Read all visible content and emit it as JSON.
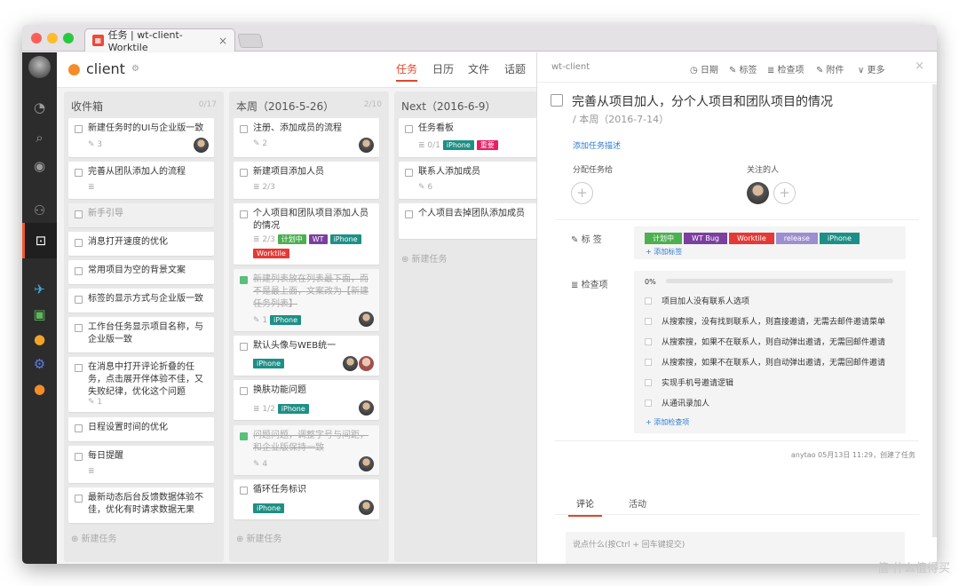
{
  "browser": {
    "tab_title": "任务 | wt-client-Worktile",
    "tab_icon": "worktile-icon"
  },
  "header": {
    "project": "client",
    "views": [
      {
        "label": "任务",
        "active": true
      },
      {
        "label": "日历",
        "active": false
      },
      {
        "label": "文件",
        "active": false
      },
      {
        "label": "话题",
        "active": false
      }
    ]
  },
  "columns": [
    {
      "title": "收件箱",
      "count": "0/17",
      "new_task": "⊕ 新建任务",
      "cards": [
        {
          "title": "新建任务时的UI与企业版一致",
          "meta": "✎ 3",
          "done": false
        },
        {
          "title": "完善从团队添加人的流程",
          "meta": "≣",
          "done": false
        },
        {
          "title": "新手引导",
          "meta": "",
          "done": false
        },
        {
          "title": "消息打开速度的优化",
          "meta": "",
          "done": false
        },
        {
          "title": "常用项目为空的背景文案",
          "meta": "",
          "done": false
        },
        {
          "title": "标签的显示方式与企业版一致",
          "meta": "",
          "done": false
        },
        {
          "title": "工作台任务显示项目名称，与企业版一致",
          "meta": "",
          "done": false
        },
        {
          "title": "在消息中打开评论折叠的任务，点击展开伴体验不佳，又失败纪律，优化这个问题",
          "meta": "✎ 1",
          "done": false
        },
        {
          "title": "日程设置时间的优化",
          "meta": "",
          "done": false
        },
        {
          "title": "每日提醒",
          "meta": "≣",
          "done": false
        },
        {
          "title": "最新动态后台反馈数据体验不佳，优化有时请求数据无果",
          "meta": "",
          "done": false
        }
      ]
    },
    {
      "title": "本周（2016-5-26）",
      "count": "2/10",
      "new_task": "⊕ 新建任务",
      "cards": [
        {
          "title": "注册、添加成员的流程",
          "meta": "✎ 2",
          "done": false
        },
        {
          "title": "新建项目添加人员",
          "meta": "≣ 2/3",
          "done": false
        },
        {
          "title": "个人项目和团队项目添加人员的情况",
          "meta": "≣ 2/3",
          "done": false,
          "tags": [
            "计划中",
            "WT",
            "iPhone",
            "Worktile"
          ]
        },
        {
          "title": "新建列表放在列表最下面，而不是最上面，文案改为【新建任务列表】",
          "meta": "✎ 1",
          "done": true,
          "tags": [
            "iPhone"
          ]
        },
        {
          "title": "默认头像与WEB统一",
          "meta": "",
          "done": false,
          "tags": [
            "iPhone"
          ]
        },
        {
          "title": "换肤功能问题",
          "meta": "≣ 1/2",
          "done": false,
          "tags": [
            "iPhone"
          ]
        },
        {
          "title": "问题问题，调整字号与间距，和企业版保持一致",
          "meta": "✎ 4",
          "done": true
        },
        {
          "title": "循环任务标识",
          "meta": "",
          "done": false,
          "tags": [
            "iPhone"
          ]
        }
      ]
    },
    {
      "title": "Next（2016-6-9）",
      "count": "",
      "new_task": "⊕ 新建任务",
      "cards": [
        {
          "title": "任务看板",
          "meta": "≣ 0/1",
          "done": false,
          "tags": [
            "iPhone",
            "重要"
          ]
        },
        {
          "title": "联系人添加成员",
          "meta": "✎ 6",
          "done": false
        },
        {
          "title": "个人项目去掉团队添加成员",
          "meta": "",
          "done": false
        }
      ]
    }
  ],
  "tag_colors": {
    "计划中": "#4caf50",
    "WT": "#7b3fa0",
    "iPhone": "#1e8f86",
    "Worktile": "#e53935",
    "重要": "#e91e63",
    "WT Bug": "#7b3fa0",
    "release": "#9c8fd0"
  },
  "detail": {
    "project": "wt-client",
    "actions": [
      "◷ 日期",
      "✎ 标签",
      "≣ 检查项",
      "✎ 附件",
      "更多"
    ],
    "title": "完善从项目加人，分个人项目和团队项目的情况",
    "list": "/ 本周（2016-7-14）",
    "add_desc": "添加任务描述",
    "assign_label": "分配任务给",
    "watchers_label": "关注的人",
    "tags_label": "标 签",
    "tags": [
      "计划中",
      "WT Bug",
      "Worktile",
      "release",
      "iPhone"
    ],
    "add_tag": "+ 添加标签",
    "checklist_label": "检查项",
    "progress": "0%",
    "progress_value": 0,
    "checklist": [
      "项目加人没有联系人选项",
      "从搜索搜，没有找到联系人，则直接邀请，无需去邮件邀请菜单",
      "从搜索搜，如果不在联系人，则自动弹出邀请，无需回邮件邀请",
      "从搜索搜，如果不在联系人，则自动弹出邀请，无需回邮件邀请",
      "实现手机号邀请逻辑",
      "从通讯录加人"
    ],
    "add_check": "+ 添加检查项",
    "activity": "anytao  05月13日 11:29，创建了任务",
    "tabs": [
      "评论",
      "活动"
    ],
    "comment_placeholder": "说点什么(按Ctrl + 回车键提交)"
  },
  "watermark": "值 什么值得买"
}
